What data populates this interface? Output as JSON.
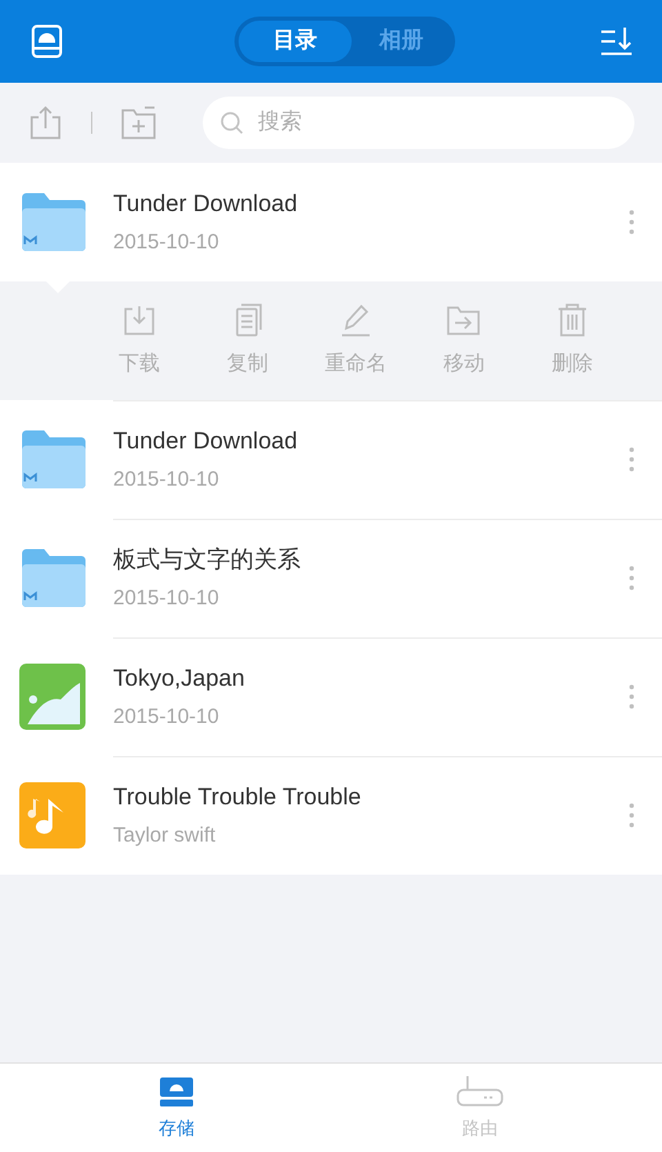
{
  "header": {
    "tabs": [
      {
        "label": "目录",
        "selected": true
      },
      {
        "label": "相册",
        "selected": false
      }
    ]
  },
  "toolbar": {
    "search": {
      "placeholder": "搜索"
    }
  },
  "files": [
    {
      "kind": "folder",
      "name": "Tunder Download",
      "subtitle": "2015-10-10",
      "expanded": true,
      "actions": [
        {
          "kind": "download",
          "label": "下载"
        },
        {
          "kind": "copy",
          "label": "复制"
        },
        {
          "kind": "rename",
          "label": "重命名"
        },
        {
          "kind": "move",
          "label": "移动"
        },
        {
          "kind": "delete",
          "label": "删除"
        }
      ]
    },
    {
      "kind": "folder",
      "name": "Tunder Download",
      "subtitle": "2015-10-10",
      "expanded": false
    },
    {
      "kind": "folder",
      "name": "板式与文字的关系",
      "subtitle": "2015-10-10",
      "expanded": false
    },
    {
      "kind": "image",
      "name": "Tokyo,Japan",
      "subtitle": "2015-10-10",
      "expanded": false
    },
    {
      "kind": "music",
      "name": "Trouble Trouble Trouble",
      "subtitle": "Taylor swift",
      "expanded": false
    }
  ],
  "tab_bar": [
    {
      "kind": "storage",
      "label": "存储",
      "selected": true
    },
    {
      "kind": "router",
      "label": "路由",
      "selected": false
    }
  ]
}
